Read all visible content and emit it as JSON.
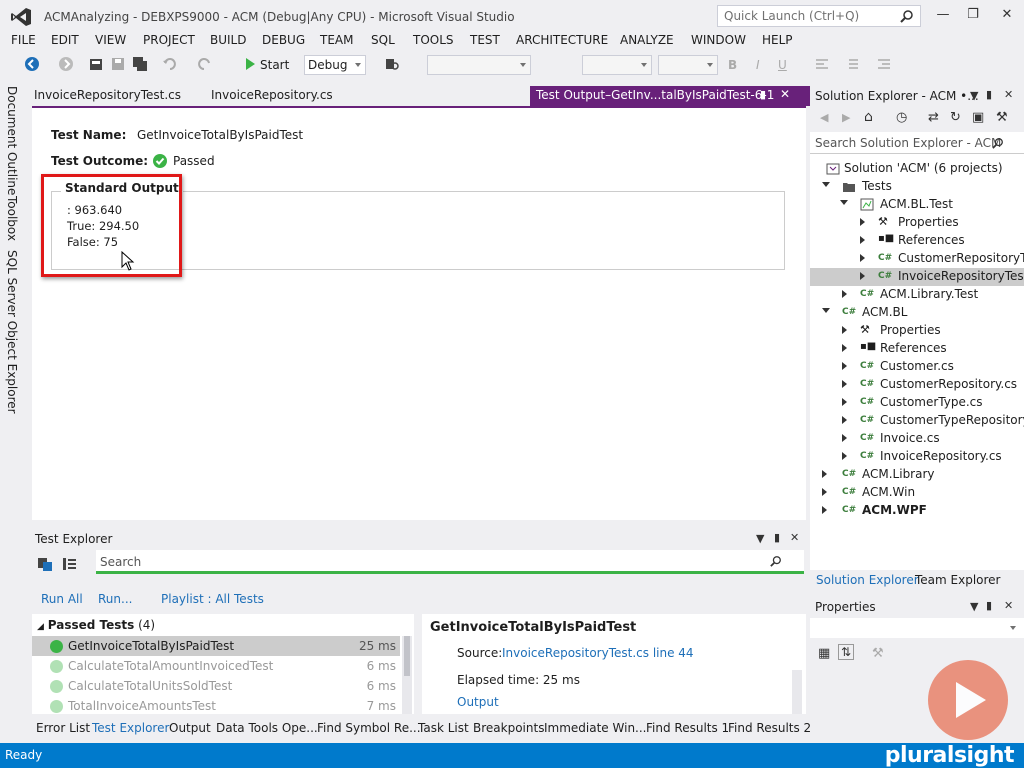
{
  "window": {
    "title": "ACMAnalyzing - DEBXPS9000 - ACM (Debug|Any CPU) - Microsoft Visual Studio",
    "quick_launch_placeholder": "Quick Launch (Ctrl+Q)"
  },
  "menu": [
    "FILE",
    "EDIT",
    "VIEW",
    "PROJECT",
    "BUILD",
    "DEBUG",
    "TEAM",
    "SQL",
    "TOOLS",
    "TEST",
    "ARCHITECTURE",
    "ANALYZE",
    "WINDOW",
    "HELP"
  ],
  "toolbar": {
    "start_label": "Start",
    "config_value": "Debug"
  },
  "side_tabs": [
    "Document Outline",
    "Toolbox",
    "SQL Server Object Explorer"
  ],
  "doc_tabs": [
    "InvoiceRepositoryTest.cs",
    "InvoiceRepository.cs"
  ],
  "active_doc_tab": "Test Output–GetInv...talByIsPaidTest-6-1",
  "test_output": {
    "name_label": "Test Name:",
    "name_value": "GetInvoiceTotalByIsPaidTest",
    "outcome_label": "Test Outcome:",
    "outcome_value": "Passed",
    "std_output_title": "Standard Output",
    "lines": [
      ": 963.640",
      "True: 294.50",
      "False: 75"
    ]
  },
  "test_explorer": {
    "title": "Test Explorer",
    "search_placeholder": "Search",
    "run_all": "Run All",
    "run": "Run...",
    "playlist": "Playlist : All Tests",
    "group_label": "Passed Tests",
    "group_count": "(4)",
    "tests": [
      {
        "name": "GetInvoiceTotalByIsPaidTest",
        "time": "25 ms"
      },
      {
        "name": "CalculateTotalAmountInvoicedTest",
        "time": "6 ms"
      },
      {
        "name": "CalculateTotalUnitsSoldTest",
        "time": "6 ms"
      },
      {
        "name": "TotalInvoiceAmountsTest",
        "time": "7 ms"
      }
    ],
    "detail": {
      "title": "GetInvoiceTotalByIsPaidTest",
      "source_label": "Source:",
      "source_link": "InvoiceRepositoryTest.cs line 44",
      "elapsed": "Elapsed time: 25 ms",
      "output_link": "Output"
    }
  },
  "bottom_tabs": [
    "Error List",
    "Test Explorer",
    "Output",
    "Data Tools Ope...",
    "Find Symbol Re...",
    "Task List",
    "Breakpoints",
    "Immediate Win...",
    "Find Results 1",
    "Find Results 2"
  ],
  "solution_explorer": {
    "title": "Solution Explorer - ACM •...",
    "search_placeholder": "Search Solution Explorer - ACM",
    "tree": [
      {
        "label": "Solution 'ACM' (6 projects)"
      },
      {
        "label": "Tests"
      },
      {
        "label": "ACM.BL.Test"
      },
      {
        "label": "Properties"
      },
      {
        "label": "References"
      },
      {
        "label": "CustomerRepositoryTe"
      },
      {
        "label": "InvoiceRepositoryTest."
      },
      {
        "label": "ACM.Library.Test"
      },
      {
        "label": "ACM.BL"
      },
      {
        "label": "Properties"
      },
      {
        "label": "References"
      },
      {
        "label": "Customer.cs"
      },
      {
        "label": "CustomerRepository.cs"
      },
      {
        "label": "CustomerType.cs"
      },
      {
        "label": "CustomerTypeRepository."
      },
      {
        "label": "Invoice.cs"
      },
      {
        "label": "InvoiceRepository.cs"
      },
      {
        "label": "ACM.Library"
      },
      {
        "label": "ACM.Win"
      },
      {
        "label": "ACM.WPF"
      }
    ],
    "tab_solution": "Solution Explorer",
    "tab_team": "Team Explorer"
  },
  "properties": {
    "title": "Properties"
  },
  "status": {
    "text": "Ready",
    "brand": "pluralsight"
  },
  "colors": {
    "accent": "#68217a",
    "status": "#007acc",
    "pass": "#3bb346",
    "highlight": "#e01818"
  }
}
